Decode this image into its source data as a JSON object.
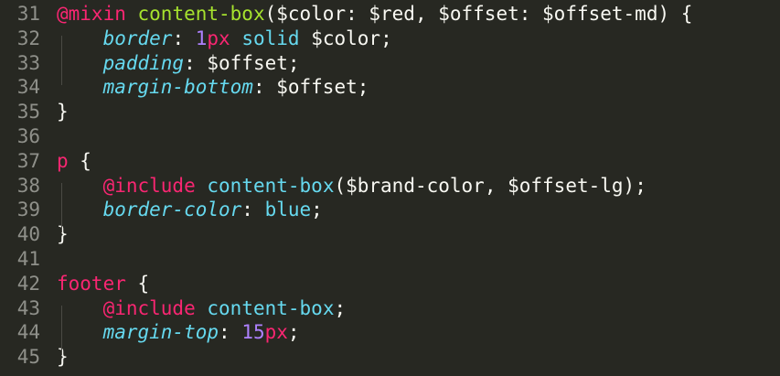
{
  "editor": {
    "theme": {
      "background": "#272822",
      "gutter_text": "#8f908a",
      "default_text": "#f8f8f2",
      "keyword_pink": "#f92672",
      "function_green": "#a6e22e",
      "property_cyan": "#66d9ef",
      "number_purple": "#ae81ff"
    },
    "lines": [
      {
        "num": "31",
        "tokens": [
          {
            "t": "@mixin",
            "c": "t-at"
          },
          {
            "t": " ",
            "c": "t-plain"
          },
          {
            "t": "content-box",
            "c": "t-fn"
          },
          {
            "t": "($color: $red, $offset: $offset-md) {",
            "c": "t-plain"
          }
        ]
      },
      {
        "num": "32",
        "tokens": [
          {
            "t": "    ",
            "c": "t-plain"
          },
          {
            "t": "border",
            "c": "t-prop"
          },
          {
            "t": ": ",
            "c": "t-plain"
          },
          {
            "t": "1",
            "c": "t-num"
          },
          {
            "t": "px",
            "c": "t-unit"
          },
          {
            "t": " ",
            "c": "t-plain"
          },
          {
            "t": "solid",
            "c": "t-val"
          },
          {
            "t": " $color;",
            "c": "t-plain"
          }
        ]
      },
      {
        "num": "33",
        "tokens": [
          {
            "t": "    ",
            "c": "t-plain"
          },
          {
            "t": "padding",
            "c": "t-prop"
          },
          {
            "t": ": $offset;",
            "c": "t-plain"
          }
        ]
      },
      {
        "num": "34",
        "tokens": [
          {
            "t": "    ",
            "c": "t-plain"
          },
          {
            "t": "margin-bottom",
            "c": "t-prop"
          },
          {
            "t": ": $offset;",
            "c": "t-plain"
          }
        ]
      },
      {
        "num": "35",
        "tokens": [
          {
            "t": "}",
            "c": "t-plain"
          }
        ]
      },
      {
        "num": "36",
        "tokens": []
      },
      {
        "num": "37",
        "tokens": [
          {
            "t": "p",
            "c": "t-tag"
          },
          {
            "t": " {",
            "c": "t-plain"
          }
        ]
      },
      {
        "num": "38",
        "tokens": [
          {
            "t": "    ",
            "c": "t-plain"
          },
          {
            "t": "@include",
            "c": "t-at"
          },
          {
            "t": " ",
            "c": "t-plain"
          },
          {
            "t": "content-box",
            "c": "t-inc-fn"
          },
          {
            "t": "($brand-color, $offset-lg);",
            "c": "t-plain"
          }
        ]
      },
      {
        "num": "39",
        "tokens": [
          {
            "t": "    ",
            "c": "t-plain"
          },
          {
            "t": "border-color",
            "c": "t-prop"
          },
          {
            "t": ": ",
            "c": "t-plain"
          },
          {
            "t": "blue",
            "c": "t-val"
          },
          {
            "t": ";",
            "c": "t-plain"
          }
        ]
      },
      {
        "num": "40",
        "tokens": [
          {
            "t": "}",
            "c": "t-plain"
          }
        ]
      },
      {
        "num": "41",
        "tokens": []
      },
      {
        "num": "42",
        "tokens": [
          {
            "t": "footer",
            "c": "t-tag"
          },
          {
            "t": " {",
            "c": "t-plain"
          }
        ]
      },
      {
        "num": "43",
        "tokens": [
          {
            "t": "    ",
            "c": "t-plain"
          },
          {
            "t": "@include",
            "c": "t-at"
          },
          {
            "t": " ",
            "c": "t-plain"
          },
          {
            "t": "content-box",
            "c": "t-inc-fn"
          },
          {
            "t": ";",
            "c": "t-plain"
          }
        ]
      },
      {
        "num": "44",
        "tokens": [
          {
            "t": "    ",
            "c": "t-plain"
          },
          {
            "t": "margin-top",
            "c": "t-prop"
          },
          {
            "t": ": ",
            "c": "t-plain"
          },
          {
            "t": "15",
            "c": "t-num"
          },
          {
            "t": "px",
            "c": "t-unit"
          },
          {
            "t": ";",
            "c": "t-plain"
          }
        ]
      },
      {
        "num": "45",
        "tokens": [
          {
            "t": "}",
            "c": "t-plain"
          }
        ]
      }
    ]
  }
}
